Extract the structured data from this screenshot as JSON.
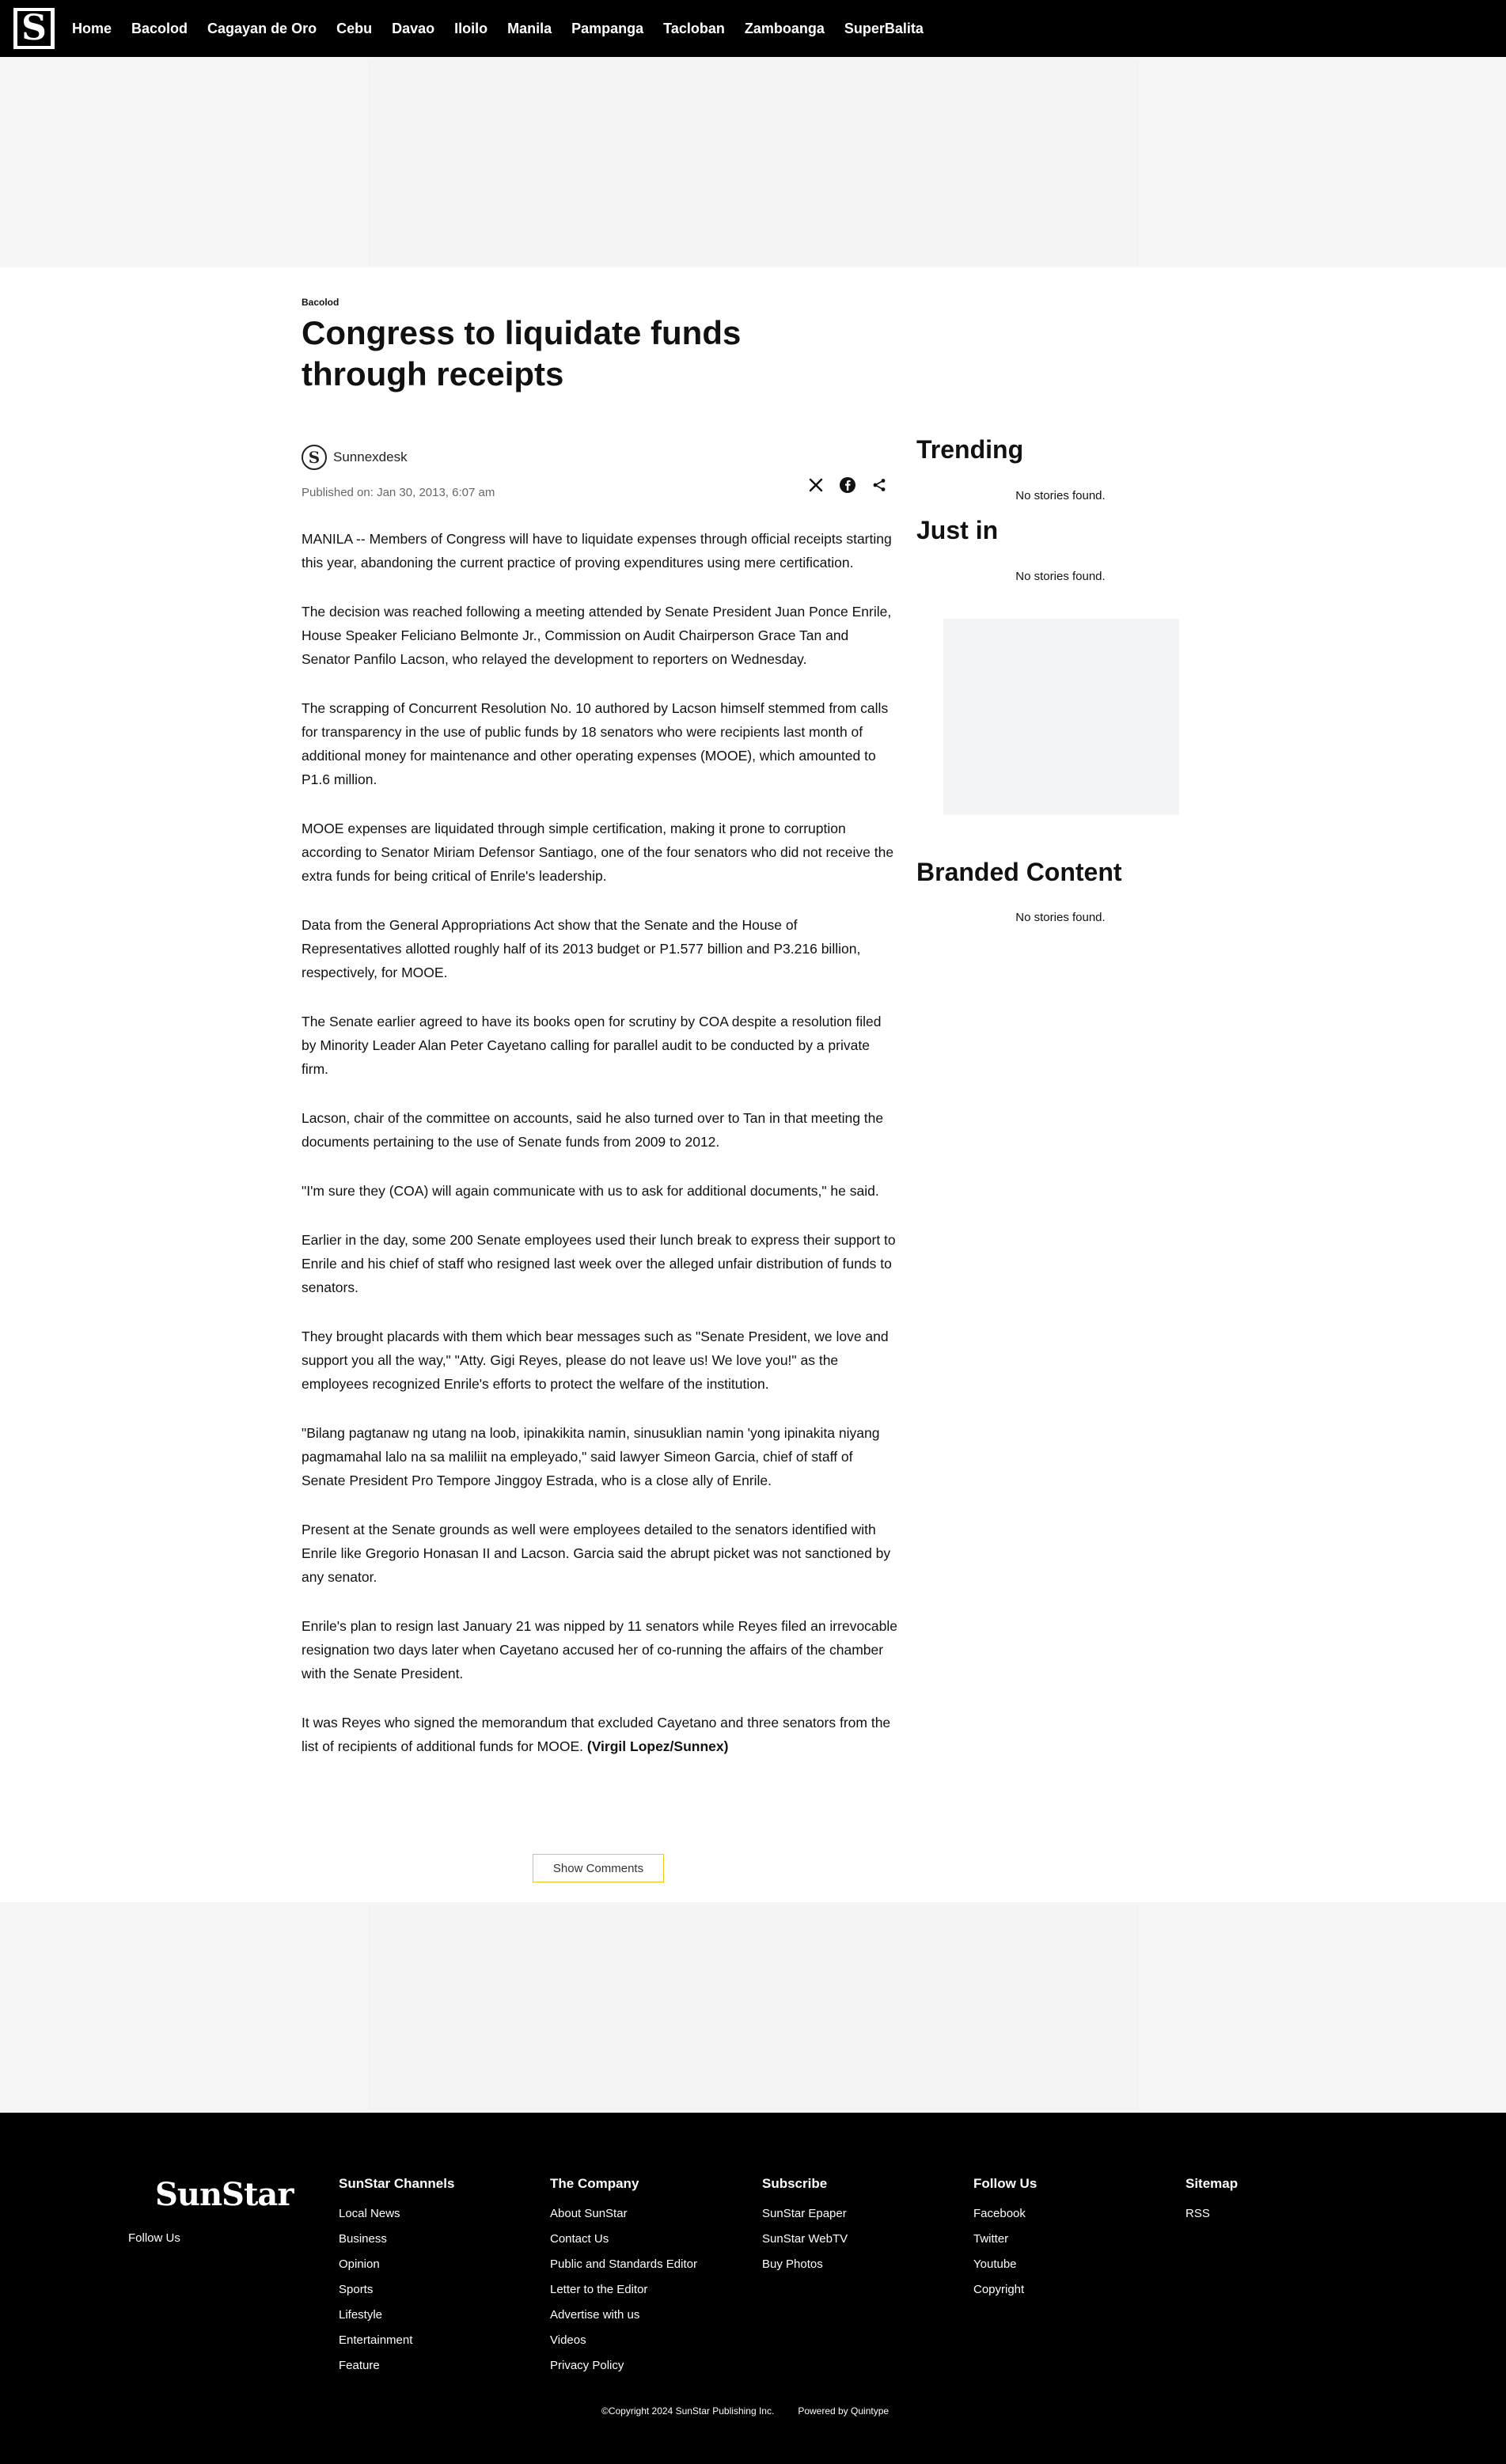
{
  "nav": {
    "logo_letter": "S",
    "items": [
      "Home",
      "Bacolod",
      "Cagayan de Oro",
      "Cebu",
      "Davao",
      "Iloilo",
      "Manila",
      "Pampanga",
      "Tacloban",
      "Zamboanga",
      "SuperBalita"
    ]
  },
  "article": {
    "section": "Bacolod",
    "title": "Congress to liquidate funds through receipts",
    "author": "Sunnexdesk",
    "published": "Published on: Jan 30, 2013, 6:07 am",
    "paragraphs": [
      "MANILA -- Members of Congress will have to liquidate expenses through official receipts starting this year, abandoning the current practice of proving expenditures using mere certification.",
      "The decision was reached following a meeting attended by Senate President Juan Ponce Enrile, House Speaker Feliciano Belmonte Jr., Commission on Audit Chairperson Grace Tan and Senator Panfilo Lacson, who relayed the development to reporters on Wednesday.",
      "The scrapping of Concurrent Resolution No. 10 authored by Lacson himself stemmed from calls for transparency in the use of public funds by 18 senators who were recipients last month of additional money for maintenance and other operating expenses (MOOE), which amounted to P1.6 million.",
      "MOOE expenses are liquidated through simple certification, making it prone to corruption according to Senator Miriam Defensor Santiago, one of the four senators who did not receive the extra funds for being critical of Enrile's leadership.",
      "Data from the General Appropriations Act show that the Senate and the House of Representatives allotted roughly half of its 2013 budget or P1.577 billion and P3.216 billion, respectively, for MOOE.",
      "The Senate earlier agreed to have its books open for scrutiny by COA despite a resolution filed by Minority Leader Alan Peter Cayetano calling for parallel audit to be conducted by a private firm.",
      "Lacson, chair of the committee on accounts, said he also turned over to Tan in that meeting the documents pertaining to the use of Senate funds from 2009 to 2012.",
      "\"I'm sure they (COA) will again communicate with us to ask for additional documents,\" he said.",
      "Earlier in the day, some 200 Senate employees used their lunch break to express their support to Enrile and his chief of staff who resigned last week over the alleged unfair distribution of funds to senators.",
      "They brought placards with them which bear messages such as \"Senate President, we love and support you all the way,\" \"Atty. Gigi Reyes, please do not leave us! We love you!\" as the employees recognized Enrile's efforts to protect the welfare of the institution.",
      "\"Bilang pagtanaw ng utang na loob, ipinakikita namin, sinusuklian namin 'yong ipinakita niyang pagmamahal lalo na sa maliliit na empleyado,\" said lawyer Simeon Garcia, chief of staff of Senate President Pro Tempore Jinggoy Estrada, who is a close ally of Enrile.",
      "Present at the Senate grounds as well were employees detailed to the senators identified with Enrile like Gregorio Honasan II and Lacson. Garcia said the abrupt picket was not sanctioned by any senator.",
      "Enrile's plan to resign last January 21 was nipped by 11 senators while Reyes filed an irrevocable resignation two days later when Cayetano accused her of co-running the affairs of the chamber with the Senate President."
    ],
    "last_paragraph": "It was Reyes who signed the memorandum that excluded Cayetano and three senators from the list of recipients of additional funds for MOOE.",
    "byline": "(Virgil Lopez/Sunnex)",
    "show_comments": "Show Comments"
  },
  "sidebar": {
    "trending_title": "Trending",
    "trending_empty": "No stories found.",
    "justin_title": "Just in",
    "justin_empty": "No stories found.",
    "branded_title": "Branded Content",
    "branded_empty": "No stories found."
  },
  "footer": {
    "logo": "SunStar",
    "follow_us": "Follow Us",
    "columns": [
      {
        "title": "SunStar Channels",
        "links": [
          "Local News",
          "Business",
          "Opinion",
          "Sports",
          "Lifestyle",
          "Entertainment",
          "Feature"
        ]
      },
      {
        "title": "The Company",
        "links": [
          "About SunStar",
          "Contact Us",
          "Public and Standards Editor",
          "Letter to the Editor",
          "Advertise with us",
          "Videos",
          "Privacy Policy"
        ]
      },
      {
        "title": "Subscribe",
        "links": [
          "SunStar Epaper",
          "SunStar WebTV",
          "Buy Photos"
        ]
      },
      {
        "title": "Follow Us",
        "links": [
          "Facebook",
          "Twitter",
          "Youtube",
          "Copyright"
        ]
      },
      {
        "title": "Sitemap",
        "links": [
          "RSS"
        ]
      }
    ],
    "copyright": "©Copyright 2024 SunStar Publishing Inc.",
    "powered": "Powered by Quintype"
  },
  "icons": {
    "share": [
      "x-icon",
      "facebook-icon",
      "share-icon"
    ]
  }
}
